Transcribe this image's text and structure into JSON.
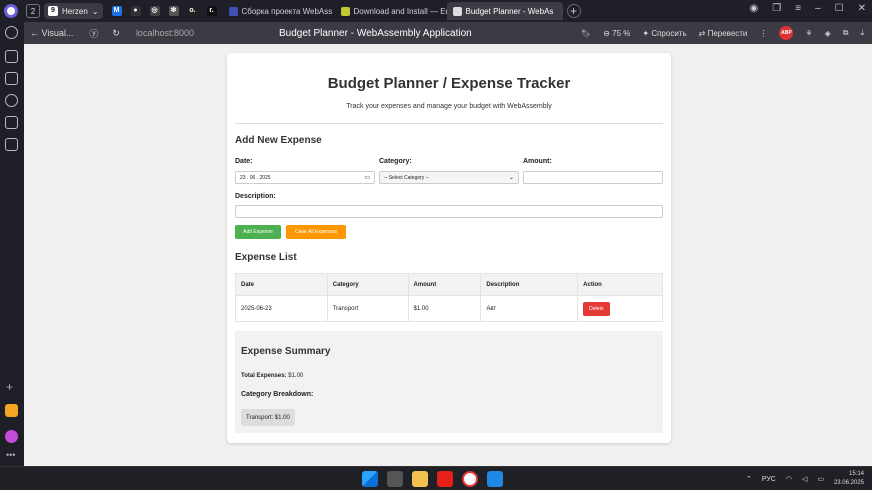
{
  "browser": {
    "tab_count": "2",
    "group_label": "Herzen",
    "tabs": [
      {
        "label": "Сборка проекта WebAss"
      },
      {
        "label": "Download and Install — Em"
      },
      {
        "label": "Budget Planner - WebAs"
      }
    ],
    "back_label": "Visual...",
    "url": "localhost:8000",
    "page_title": "Budget Planner - WebAssembly Application",
    "zoom": "75 %",
    "ask_label": "Спросить",
    "translate_label": "Перевести",
    "abp_label": "ABP"
  },
  "app": {
    "title": "Budget Planner / Expense Tracker",
    "subtitle": "Track your expenses and manage your budget with WebAssembly",
    "form": {
      "heading": "Add New Expense",
      "date_label": "Date:",
      "date_value": "23 . 06 . 2025",
      "category_label": "Category:",
      "category_value": "-- Select Category --",
      "amount_label": "Amount:",
      "description_label": "Description:",
      "add_button": "Add Expense",
      "clear_button": "Clear All Expenses"
    },
    "list": {
      "heading": "Expense List",
      "columns": [
        "Date",
        "Category",
        "Amount",
        "Description",
        "Action"
      ],
      "rows": [
        {
          "date": "2025-06-23",
          "category": "Transport",
          "amount": "$1.00",
          "description": "Авт",
          "action": "Delete"
        }
      ]
    },
    "summary": {
      "heading": "Expense Summary",
      "total_label": "Total Expenses:",
      "total_value": "$1.00",
      "breakdown_heading": "Category Breakdown:",
      "chips": [
        "Transport: $1.00"
      ]
    }
  },
  "taskbar": {
    "lang": "РУС",
    "time": "15:14",
    "date": "23.06.2025"
  },
  "colors": {
    "add_button": "#4caf50",
    "clear_button": "#ff9800",
    "delete_button": "#e53935"
  }
}
